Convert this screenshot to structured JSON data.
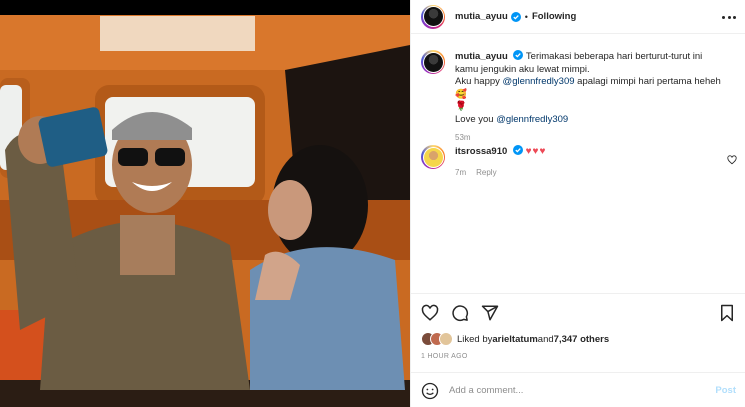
{
  "post": {
    "author": "mutia_ayuu",
    "follow_status": "Following",
    "caption_line1": "Terimakasi beberapa hari berturut-turut ini kamu jengukin aku lewat mimpi.",
    "caption_line2_prefix": "Aku happy ",
    "caption_mention1": "@glennfredly309",
    "caption_line2_suffix": " apalagi mimpi hari pertama heheh 🥰",
    "caption_rose": "🌹",
    "caption_line3_prefix": "Love you ",
    "caption_mention2": "@glennfredly309",
    "caption_time": "53m"
  },
  "comment": {
    "author": "itsrossa910",
    "text": "♥♥♥",
    "time": "7m",
    "reply_label": "Reply"
  },
  "likes": {
    "prefix": "Liked by ",
    "first_liker": "arieltatum",
    "middle": " and ",
    "others": "7,347 others",
    "posted_ago": "1 HOUR AGO"
  },
  "add_comment": {
    "placeholder": "Add a comment...",
    "post_label": "Post"
  },
  "colors": {
    "accent_blue": "#0095f6",
    "mention": "#00376b",
    "heart": "#ed4956",
    "post_disabled": "#b2dffc"
  }
}
